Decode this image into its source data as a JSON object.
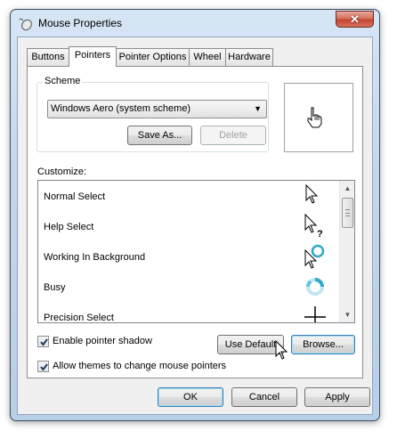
{
  "window": {
    "title": "Mouse Properties",
    "close_label": "✕",
    "title_icon": "mouse-icon"
  },
  "tabs": [
    {
      "label": "Buttons"
    },
    {
      "label": "Pointers"
    },
    {
      "label": "Pointer Options"
    },
    {
      "label": "Wheel"
    },
    {
      "label": "Hardware"
    }
  ],
  "active_tab": "Pointers",
  "scheme": {
    "label": "Scheme",
    "selected": "Windows Aero (system scheme)",
    "save_as_label": "Save As...",
    "delete_label": "Delete"
  },
  "preview_icon": "hand-pointer-icon",
  "customize": {
    "label": "Customize:",
    "items": [
      {
        "label": "Normal Select",
        "icon": "arrow-cursor-icon"
      },
      {
        "label": "Help Select",
        "icon": "help-cursor-icon"
      },
      {
        "label": "Working In Background",
        "icon": "working-cursor-icon"
      },
      {
        "label": "Busy",
        "icon": "busy-ring-icon"
      },
      {
        "label": "Precision Select",
        "icon": "crosshair-icon"
      }
    ]
  },
  "options": {
    "shadow_label": "Enable pointer shadow",
    "shadow_checked": true,
    "themes_label": "Allow themes to change mouse pointers",
    "themes_checked": true,
    "use_default_label": "Use Default",
    "browse_label": "Browse..."
  },
  "footer": {
    "ok_label": "OK",
    "cancel_label": "Cancel",
    "apply_label": "Apply"
  },
  "colors": {
    "accent": "#3c7fb1",
    "busy_ring": "#2fa8c9"
  }
}
